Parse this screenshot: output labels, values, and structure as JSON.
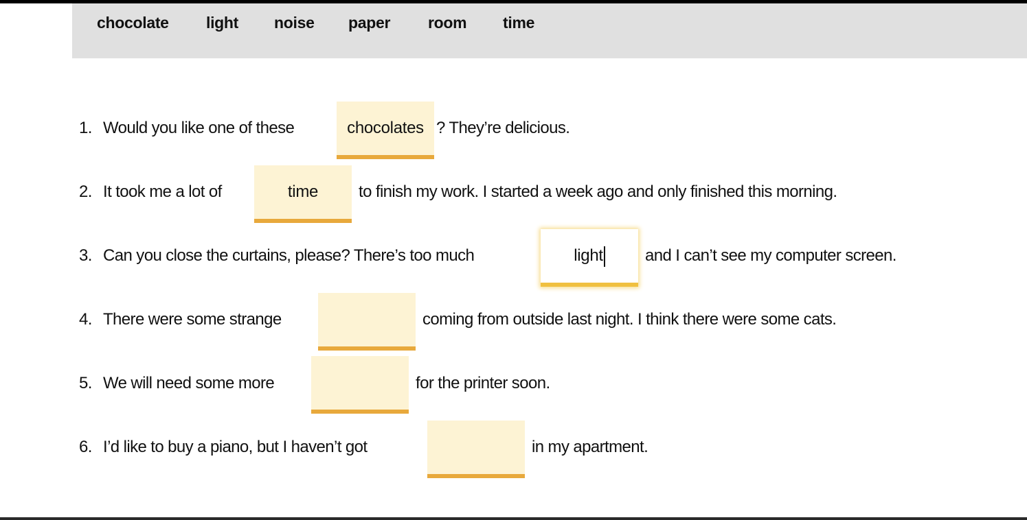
{
  "word_bank": [
    "chocolate",
    "light",
    "noise",
    "paper",
    "room",
    "time"
  ],
  "items": [
    {
      "number": "1.",
      "before": "Would you like one of these",
      "answer": "chocolates",
      "after": "? They’re delicious."
    },
    {
      "number": "2.",
      "before": "It took me a lot of",
      "answer": "time",
      "after": "to finish my work. I started a week ago and only finished this morning."
    },
    {
      "number": "3.",
      "before": "Can you close the curtains, please? There’s too much",
      "answer": "light",
      "after": "and I can’t see my computer screen."
    },
    {
      "number": "4.",
      "before": "There were some strange",
      "answer": "",
      "after": "coming from outside last night. I think there were some cats."
    },
    {
      "number": "5.",
      "before": "We will need some more",
      "answer": "",
      "after": "for the printer soon."
    },
    {
      "number": "6.",
      "before": "I’d like to buy a piano, but I haven’t got",
      "answer": "",
      "after": "in my apartment."
    }
  ],
  "colors": {
    "gap_fill": "#fdf3d4",
    "gap_underline": "#e8a93c",
    "word_bank_bg": "#e0e0e0"
  }
}
